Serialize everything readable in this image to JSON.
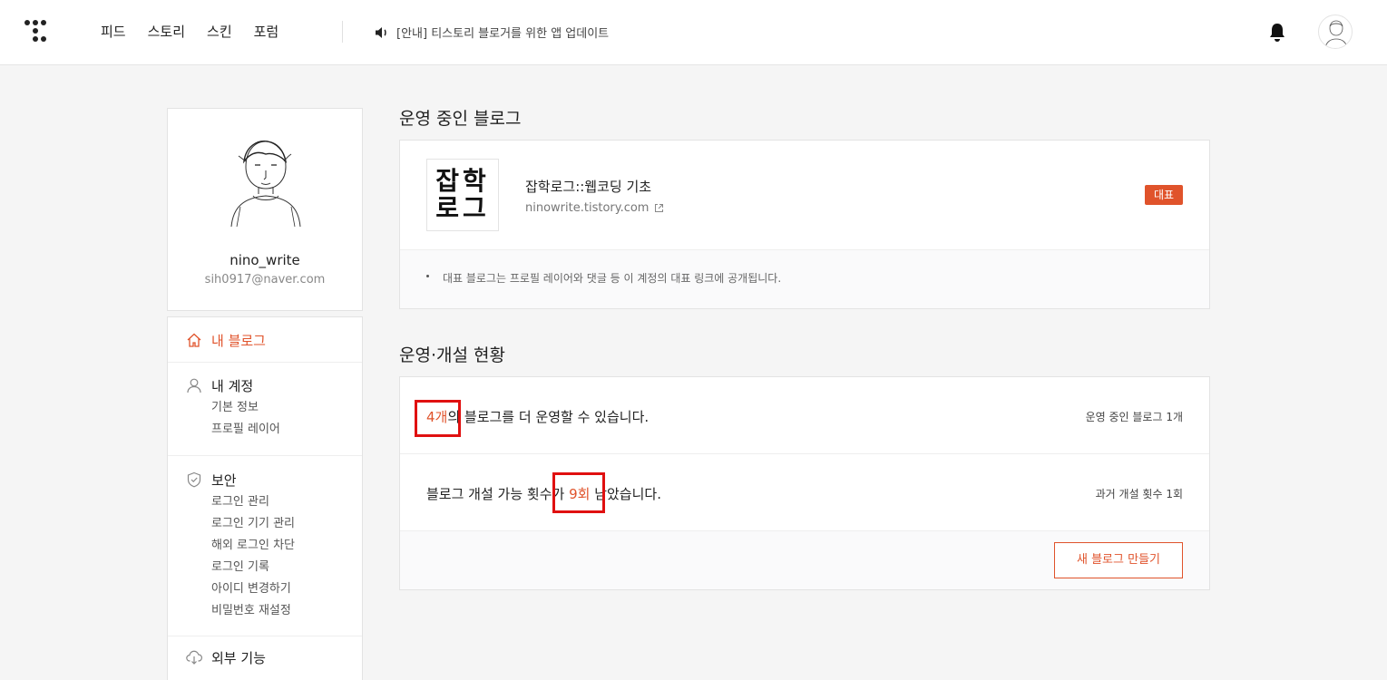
{
  "header": {
    "nav": [
      "피드",
      "스토리",
      "스킨",
      "포럼"
    ],
    "notice": "[안내] 티스토리 블로거를 위한 앱 업데이트"
  },
  "profile": {
    "name": "nino_write",
    "email": "sih0917@naver.com"
  },
  "sidebar": {
    "my_blog": "내 블로그",
    "account": {
      "label": "내 계정",
      "items": [
        "기본 정보",
        "프로필 레이어"
      ]
    },
    "security": {
      "label": "보안",
      "items": [
        "로그인 관리",
        "로그인 기기 관리",
        "해외 로그인 차단",
        "로그인 기록",
        "아이디 변경하기",
        "비밀번호 재설정"
      ]
    },
    "external": "외부 기능"
  },
  "blogs_section": {
    "title": "운영 중인 블로그",
    "blog": {
      "thumb_line1": "잡학",
      "thumb_line2": "로그",
      "name": "잡학로그::웹코딩 기초",
      "url": "ninowrite.tistory.com",
      "badge": "대표"
    },
    "note": "대표 블로그는 프로필 레이어와 댓글 등 이 계정의 대표 링크에 공개됩니다."
  },
  "status_section": {
    "title": "운영·개설 현황",
    "row1": {
      "highlight": "4개",
      "text_after": "의 블로그를 더 운영할 수 있습니다.",
      "side": "운영 중인 블로그 1개"
    },
    "row2": {
      "text_before": "블로그 개설 가능 횟수가 ",
      "highlight": "9회",
      "text_after": " 남았습니다.",
      "side": "과거 개설 횟수 1회"
    },
    "new_blog_button": "새 블로그 만들기"
  },
  "colors": {
    "accent": "#e0532b",
    "annotation_box": "#e01010"
  }
}
